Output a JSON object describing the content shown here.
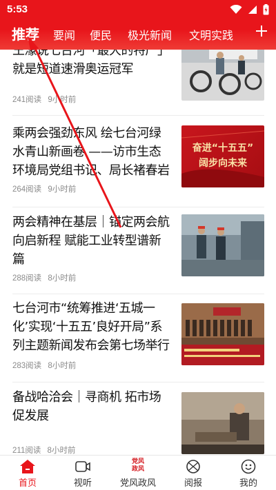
{
  "status": {
    "time": "5:53"
  },
  "tabs": [
    {
      "label": "推荐",
      "active": true
    },
    {
      "label": "要闻"
    },
    {
      "label": "便民"
    },
    {
      "label": "极光新闻"
    },
    {
      "label": "文明实践"
    }
  ],
  "tabs_add_icon": "plus-icon",
  "feed": [
    {
      "title": "王濛说七台河「最大的特产」就是短道速滑奥运冠军",
      "reads": "241阅读",
      "time": "9小时前",
      "thumb": "spin-bikes-photo"
    },
    {
      "title": "乘两会强劲东风 绘七台河绿水青山新画卷 ——访市生态环境局党组书记、局长褚春岩",
      "reads": "264阅读",
      "time": "9小时前",
      "thumb": "banner-photo",
      "thumb_text_1": "奋进“十五五”",
      "thumb_text_2": "阔步向未来"
    },
    {
      "title": "两会精神在基层｜锚定两会航向启新程 赋能工业转型谱新篇",
      "reads": "288阅读",
      "time": "8小时前",
      "thumb": "factory-photo"
    },
    {
      "title": "七台河市“统筹推进‘五城一化’实现‘十五五’良好开局”系列主题新闻发布会第七场举行",
      "reads": "283阅读",
      "time": "8小时前",
      "thumb": "press-conference-photo"
    },
    {
      "title": "备战哈洽会｜寻商机 拓市场 促发展",
      "reads": "211阅读",
      "time": "8小时前",
      "thumb": "craftsman-photo"
    }
  ],
  "bottom_nav": [
    {
      "label": "首页",
      "icon": "home-icon",
      "active": true
    },
    {
      "label": "视听",
      "icon": "video-icon"
    },
    {
      "label": "党风政风",
      "icon": "party-style-icon",
      "icon_text_1": "党风",
      "icon_text_2": "政风"
    },
    {
      "label": "阅报",
      "icon": "newspaper-icon"
    },
    {
      "label": "我的",
      "icon": "profile-icon"
    }
  ],
  "colors": {
    "brand_red": "#e8151b",
    "meta_gray": "#8a8a8a"
  }
}
